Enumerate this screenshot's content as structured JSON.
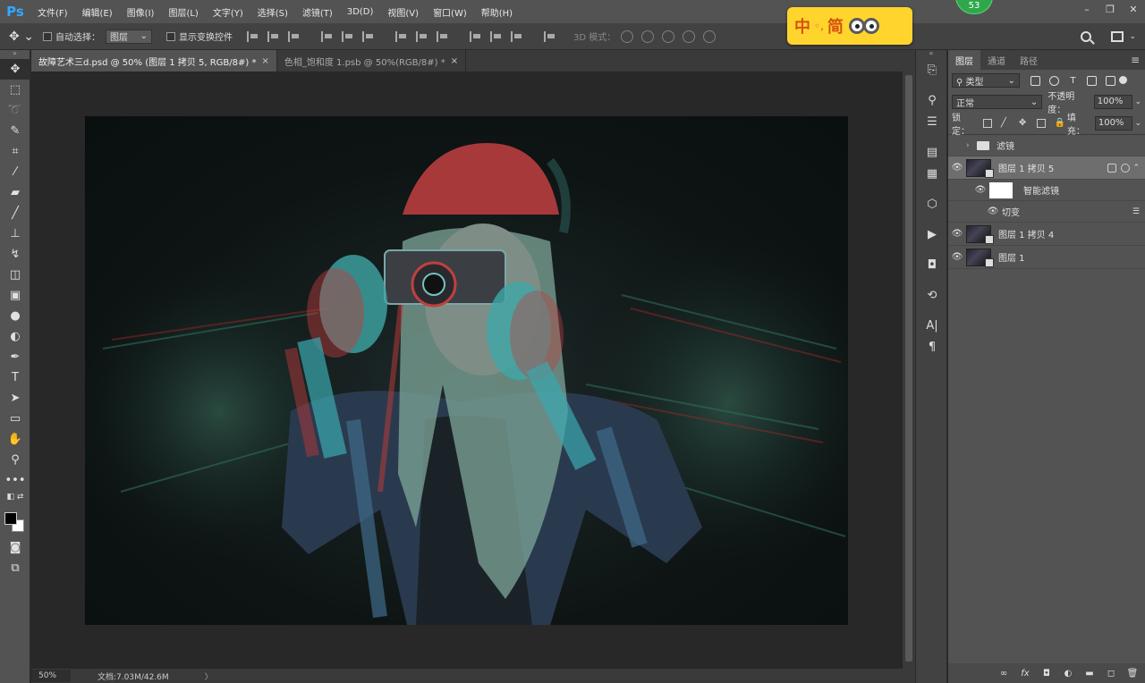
{
  "app": {
    "logo": "Ps",
    "menu": [
      "文件(F)",
      "编辑(E)",
      "图像(I)",
      "图层(L)",
      "文字(Y)",
      "选择(S)",
      "滤镜(T)",
      "3D(D)",
      "视图(V)",
      "窗口(W)",
      "帮助(H)"
    ],
    "badge": "53",
    "window_controls": [
      "–",
      "❐",
      "✕"
    ]
  },
  "ime": {
    "lang": "中",
    "sep": "◦,",
    "mode": "简"
  },
  "options": {
    "auto_select_label": "自动选择：",
    "auto_select_value": "图层",
    "show_transform_label": "显示变换控件",
    "mode_3d_label": "3D 模式："
  },
  "tabs": [
    {
      "label": "故障艺术三d.psd @ 50% (图层 1 拷贝 5, RGB/8#) *",
      "close": "×"
    },
    {
      "label": "色相_饱和度 1.psb @ 50%(RGB/8#) *",
      "close": "×"
    }
  ],
  "status": {
    "zoom": "50%",
    "doc": "文档:7.03M/42.6M",
    "arrow": "〉"
  },
  "layers_panel": {
    "tabs": [
      "图层",
      "通道",
      "路径"
    ],
    "menu_icon": "≡",
    "filter_type": "类型",
    "blend_mode": "正常",
    "opacity_label": "不透明度：",
    "opacity_value": "100%",
    "lock_label": "锁定：",
    "fill_label": "填充：",
    "fill_value": "100%",
    "layers": [
      {
        "name": "滤镜",
        "type": "group"
      },
      {
        "name": "图层 1 拷贝 5",
        "type": "smart"
      },
      {
        "name": "智能滤镜",
        "type": "smart-filter"
      },
      {
        "name": "切变",
        "type": "filter"
      },
      {
        "name": "图层 1 拷贝 4",
        "type": "layer"
      },
      {
        "name": "图层 1",
        "type": "layer"
      }
    ],
    "footer_icons": [
      "link-icon",
      "fx-icon",
      "mask-icon",
      "adjustment-icon",
      "folder-icon",
      "new-layer-icon",
      "trash-icon"
    ],
    "fx_label": "fx"
  },
  "colors": {
    "accent": "#31a8ff",
    "ime_bg": "#ffd52d",
    "badge_bg": "#2ea84b"
  }
}
